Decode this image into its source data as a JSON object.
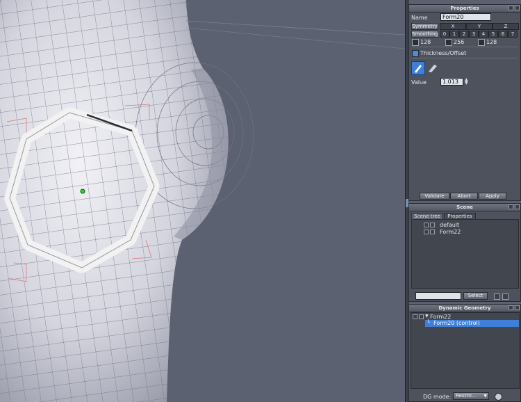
{
  "viewport": {
    "label": "3D viewport - mesh editing"
  },
  "properties": {
    "title": "Properties",
    "name_label": "Name",
    "name_value": "Form20",
    "symmetry_label": "Symmetry",
    "axes": [
      "X",
      "Y",
      "Z"
    ],
    "smoothing_label": "Smoothing",
    "smoothing_levels": [
      "0",
      "1",
      "2",
      "3",
      "4",
      "5",
      "6",
      "7"
    ],
    "poly_counts": [
      "128",
      "256",
      "128"
    ],
    "tool_label": "Thickness/Offset",
    "value_label": "Value",
    "value": "1.013",
    "validate": "Validate",
    "abort": "Abort",
    "apply": "Apply"
  },
  "scene": {
    "title": "Scene",
    "tabs": [
      "Scene tree",
      "Properties"
    ],
    "items": [
      "default",
      "Form22"
    ],
    "select_button": "Select"
  },
  "dynamic_geometry": {
    "title": "Dynamic Geometry",
    "items": [
      "Form22",
      "Form20 (control)"
    ],
    "dg_mode_label": "DG mode:",
    "dg_mode_value": "Restric..."
  },
  "colors": {
    "accent": "#3f7fd8",
    "panel": "#4e525c",
    "viewport": "#5b6170"
  }
}
